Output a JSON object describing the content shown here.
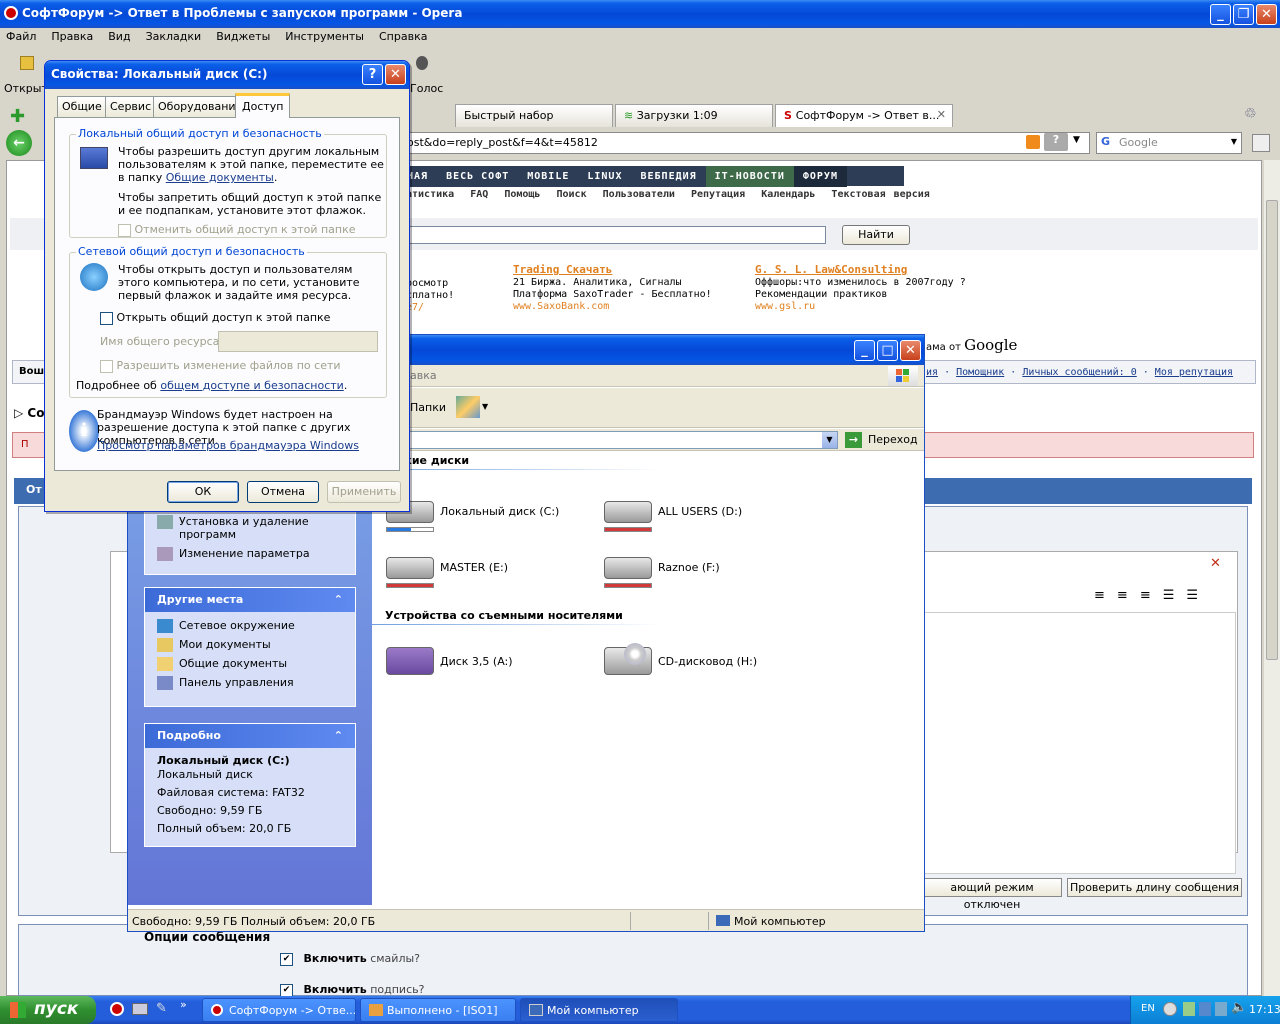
{
  "opera": {
    "title": "СофтФорум -> Ответ в Проблемы с запуском программ - Opera",
    "menu": [
      "Файл",
      "Правка",
      "Вид",
      "Закладки",
      "Виджеты",
      "Инструменты",
      "Справка"
    ],
    "toolbar": {
      "open": "Открыт",
      "voice": "Голос"
    },
    "tabs": [
      "Быстрый набор",
      "Загрузки 1:09",
      "СофтФорум -> Ответ в..."
    ],
    "address": "ost&do=reply_post&f=4&t=45812",
    "search_placeholder": "Google",
    "site_nav": [
      "НАЯ",
      "ВЕСЬ СОФТ",
      "MOBILE",
      "LINUX",
      "ВЕБПЕДИЯ",
      "IT-НОВОСТИ",
      "ФОРУМ"
    ],
    "sub_nav": [
      "атистика",
      "FAQ",
      "Помощь",
      "Поиск",
      "Пользователи",
      "Репутация",
      "Календарь",
      "Текстовая версия"
    ],
    "find_button": "Найти",
    "ads": [
      {
        "title": "",
        "l1": "росмотр",
        "l2": "сплатно!",
        "l3": "e7/"
      },
      {
        "title": "Trading Скачать",
        "l1": "21 Биржа. Аналитика, Сигналы",
        "l2": "Платформа SaxoTrader - Бесплатно!",
        "l3": "www.SaxoBank.com"
      },
      {
        "title": "G. S. L. Law&Consulting",
        "l1": "Оффшоры:что изменилось в 2007году ?",
        "l2": "Рекомендации практиков",
        "l3": "www.gsl.ru"
      }
    ],
    "google_ads": "ама от",
    "google": "Google",
    "user_links": [
      "ия",
      "Помощник",
      "Личных сообщений: 0",
      "Моя репутация"
    ],
    "left_cut": {
      "vosh": "Вош",
      "so": "Со",
      "p": "П",
      "ot": "От"
    },
    "bottom_buttons": [
      "ающий режим отключен",
      "Проверить длину сообщения"
    ],
    "options_title": "Опции сообщения",
    "opt1_bold": "Включить",
    "opt1": "смайлы?",
    "opt2_bold": "Включить",
    "opt2": "подпись?"
  },
  "explorer": {
    "menu_cut": "авка",
    "folders": "Папки",
    "go": "Переход",
    "section_hdd": "ткие диски",
    "section_removable": "Устройства со съемными носителями",
    "drives": [
      {
        "name": "Локальный диск (C:)",
        "fill": 0.52,
        "color": "#2a7ae0"
      },
      {
        "name": "ALL USERS (D:)",
        "fill": 1.0,
        "color": "#d03a3a"
      },
      {
        "name": "MASTER (E:)",
        "fill": 1.0,
        "color": "#d03a3a"
      },
      {
        "name": "Raznoe (F:)",
        "fill": 1.0,
        "color": "#d03a3a"
      }
    ],
    "removable": [
      "Диск 3,5 (A:)",
      "CD-дисковод (H:)"
    ],
    "tasks": [
      "Установка и удаление программ",
      "Изменение параметра"
    ],
    "places_title": "Другие места",
    "places": [
      "Сетевое окружение",
      "Мои документы",
      "Общие документы",
      "Панель управления"
    ],
    "details_title": "Подробно",
    "details": {
      "name": "Локальный диск (C:)",
      "type": "Локальный диск",
      "fs": "Файловая система: FAT32",
      "free": "Свободно: 9,59 ГБ",
      "total": "Полный объем: 20,0 ГБ"
    },
    "status": "Свободно: 9,59 ГБ Полный объем: 20,0 ГБ",
    "status_right": "Мой компьютер"
  },
  "dialog": {
    "title": "Свойства: Локальный диск (C:)",
    "tabs": [
      "Общие",
      "Сервис",
      "Оборудование",
      "Доступ"
    ],
    "group1": "Локальный общий доступ и безопасность",
    "g1_text1": "Чтобы разрешить доступ другим локальным пользователям к этой папке, переместите ее в папку",
    "g1_link": "Общие документы",
    "g1_text2": "Чтобы запретить общий доступ к этой папке и ее подпапкам, установите этот флажок.",
    "g1_check": "Отменить общий доступ к этой папке",
    "group2": "Сетевой общий доступ и безопасность",
    "g2_text": "Чтобы открыть доступ и пользователям этого компьютера, и по сети, установите первый флажок и задайте имя ресурса.",
    "g2_check1": "Открыть общий доступ к этой папке",
    "g2_name_label": "Имя общего ресурса:",
    "g2_check2": "Разрешить изменение файлов по сети",
    "g2_more": "Подробнее об",
    "g2_more_link": "общем доступе и безопасности",
    "fw_text": "Брандмауэр Windows будет настроен на разрешение доступа к этой папке с других компьютеров в сети.",
    "fw_link": "Просмотр параметров брандмауэра Windows",
    "ok": "ОК",
    "cancel": "Отмена",
    "apply": "Применить"
  },
  "taskbar": {
    "start": "пуск",
    "tasks": [
      "СофтФорум -> Отве...",
      "Выполнено - [ISO1]",
      "Мой компьютер"
    ],
    "lang": "EN",
    "clock": "17:13"
  }
}
